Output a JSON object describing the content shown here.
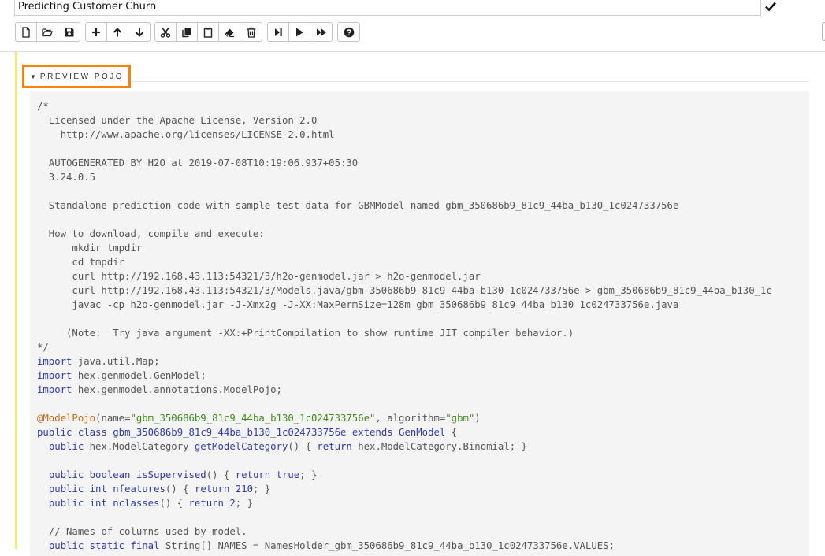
{
  "notebook": {
    "title": "Predicting Customer Churn"
  },
  "toolbar": {
    "groups": [
      [
        "new-file-icon",
        "open-folder-icon",
        "save-icon"
      ],
      [
        "plus-icon",
        "arrow-up-icon",
        "arrow-down-icon"
      ],
      [
        "cut-icon",
        "copy-icon",
        "paste-icon",
        "eraser-icon",
        "trash-icon"
      ],
      [
        "step-forward-icon",
        "play-icon",
        "fast-forward-icon"
      ],
      [
        "help-icon"
      ]
    ]
  },
  "section": {
    "label": "PREVIEW POJO"
  },
  "code": {
    "lines": [
      "/*",
      "  Licensed under the Apache License, Version 2.0",
      "    http://www.apache.org/licenses/LICENSE-2.0.html",
      "",
      "  AUTOGENERATED BY H2O at 2019-07-08T10:19:06.937+05:30",
      "  3.24.0.5",
      "",
      "  Standalone prediction code with sample test data for GBMModel named gbm_350686b9_81c9_44ba_b130_1c024733756e",
      "",
      "  How to download, compile and execute:",
      "      mkdir tmpdir",
      "      cd tmpdir",
      "      curl http://192.168.43.113:54321/3/h2o-genmodel.jar > h2o-genmodel.jar",
      "      curl http://192.168.43.113:54321/3/Models.java/gbm-350686b9-81c9-44ba-b130-1c024733756e > gbm_350686b9_81c9_44ba_b130_1c",
      "      javac -cp h2o-genmodel.jar -J-Xmx2g -J-XX:MaxPermSize=128m gbm_350686b9_81c9_44ba_b130_1c024733756e.java",
      "",
      "     (Note:  Try java argument -XX:+PrintCompilation to show runtime JIT compiler behavior.)",
      "*/",
      "import java.util.Map;",
      "import hex.genmodel.GenModel;",
      "import hex.genmodel.annotations.ModelPojo;",
      "",
      "@ModelPojo(name=\"gbm_350686b9_81c9_44ba_b130_1c024733756e\", algorithm=\"gbm\")",
      "public class gbm_350686b9_81c9_44ba_b130_1c024733756e extends GenModel {",
      "  public hex.ModelCategory getModelCategory() { return hex.ModelCategory.Binomial; }",
      "",
      "  public boolean isSupervised() { return true; }",
      "  public int nfeatures() { return 210; }",
      "  public int nclasses() { return 2; }",
      "",
      "  // Names of columns used by model.",
      "  public static final String[] NAMES = NamesHolder_gbm_350686b9_81c9_44ba_b130_1c024733756e.VALUES;"
    ]
  },
  "colors": {
    "keyword": "#2e3cab",
    "string": "#3f8a1c",
    "annotation": "#c76d1c",
    "highlight_border": "#f2840f",
    "cell_bar": "#f3ea78"
  }
}
